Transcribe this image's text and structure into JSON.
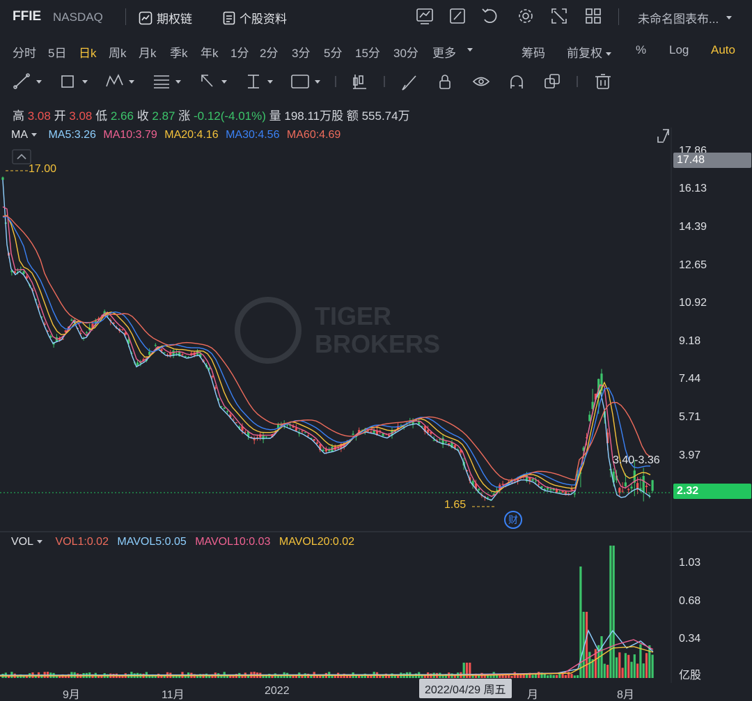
{
  "header": {
    "symbol": "FFIE",
    "exchange": "NASDAQ",
    "options_chain": "期权链",
    "stock_profile": "个股资料",
    "layout_name": "未命名图表布..."
  },
  "periods": [
    "分时",
    "5日",
    "日k",
    "周k",
    "月k",
    "季k",
    "年k",
    "1分",
    "2分",
    "3分",
    "5分",
    "15分",
    "30分",
    "更多"
  ],
  "active_period": "日k",
  "right_toolbar": {
    "chips": "筹码",
    "adjust": "前复权",
    "percent": "%",
    "log": "Log",
    "auto": "Auto"
  },
  "quote": {
    "high_label": "高",
    "high": "3.08",
    "open_label": "开",
    "open": "3.08",
    "low_label": "低",
    "low": "2.66",
    "close_label": "收",
    "close": "2.87",
    "change_label": "涨",
    "change": "-0.12(-4.01%)",
    "volume_label": "量",
    "volume": "198.11万股",
    "amount_label": "额",
    "amount": "555.74万"
  },
  "ma_legend": {
    "label": "MA",
    "ma5": "MA5:3.26",
    "ma10": "MA10:3.79",
    "ma20": "MA20:4.16",
    "ma30": "MA30:4.56",
    "ma60": "MA60:4.69"
  },
  "vol_legend": {
    "label": "VOL",
    "vol1": "VOL1:0.02",
    "mavol5": "MAVOL5:0.05",
    "mavol10": "MAVOL10:0.03",
    "mavol20": "MAVOL20:0.02"
  },
  "price_axis": [
    "17.86",
    "16.13",
    "14.39",
    "12.65",
    "10.92",
    "9.18",
    "7.44",
    "5.71",
    "3.97"
  ],
  "vol_axis": [
    "1.03",
    "0.68",
    "0.34",
    "亿股"
  ],
  "x_axis": [
    "9月",
    "11月",
    "2022",
    "月",
    "8月"
  ],
  "crosshair_date": "2022/04/29 周五",
  "tags": {
    "current_price": "2.32",
    "hover_price": "17.48",
    "max_label": "17.00",
    "min_label": "1.65",
    "range_label": "3.40-3.36",
    "earnings": "财"
  },
  "watermark": {
    "line1": "TIGER",
    "line2": "BROKERS"
  },
  "colors": {
    "up": "#ef5350",
    "down": "#3cc46a",
    "ma5": "#8fd0ff",
    "ma10": "#f06292",
    "ma20": "#f5c33b",
    "ma30": "#3b82f6",
    "ma60": "#ef6c5c",
    "active": "#f5c33b",
    "price_tag": "#22c55e"
  }
}
